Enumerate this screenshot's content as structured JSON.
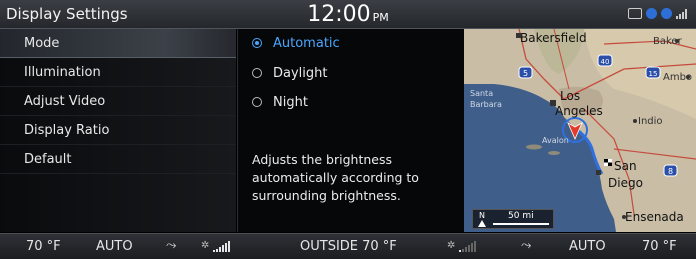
{
  "header": {
    "title": "Display Settings",
    "time": "12:00",
    "ampm": "PM",
    "status_icons": [
      "camera-icon",
      "bluetooth-icon",
      "signal-icon"
    ]
  },
  "menu": {
    "items": [
      {
        "label": "Mode",
        "active": true
      },
      {
        "label": "Illumination",
        "active": false
      },
      {
        "label": "Adjust Video",
        "active": false
      },
      {
        "label": "Display Ratio",
        "active": false
      },
      {
        "label": "Default",
        "active": false
      }
    ]
  },
  "mode_options": {
    "items": [
      {
        "label": "Automatic",
        "selected": true
      },
      {
        "label": "Daylight",
        "selected": false
      },
      {
        "label": "Night",
        "selected": false
      }
    ],
    "description": "Adjusts the brightness automatically according to surrounding brightness."
  },
  "map": {
    "cities": [
      "Bakersfield",
      "Baker",
      "Amboy",
      "Los Angeles",
      "Indio",
      "San Diego",
      "Ensenada",
      "Santa Barbara"
    ],
    "city_display": {
      "bakersfield": "Bakersfield",
      "baker": "Baker",
      "amboy": "Ambo",
      "los": "Los",
      "angeles": "Angeles",
      "indio": "Indio",
      "san": "San",
      "diego": "Diego",
      "ensenada": "Ensenada",
      "santa": "Santa",
      "barbara": "Barbara",
      "avalon": "Avalon"
    },
    "highway_shields": [
      "5",
      "40",
      "15",
      "8"
    ],
    "scale_north": "N",
    "scale_distance": "50 mi"
  },
  "climate": {
    "driver_temp": "70 °F",
    "driver_mode": "AUTO",
    "outside": "OUTSIDE  70 °F",
    "passenger_mode": "AUTO",
    "passenger_temp": "70 °F",
    "fan_left_level": 6,
    "fan_right_level": 1,
    "fan_levels_max": 6
  },
  "colors": {
    "accent": "#4aa6ff",
    "water": "#3f5f8a",
    "land": "#c9bda5",
    "route": "#2f6fe0",
    "position_marker": "#e23b2a"
  }
}
